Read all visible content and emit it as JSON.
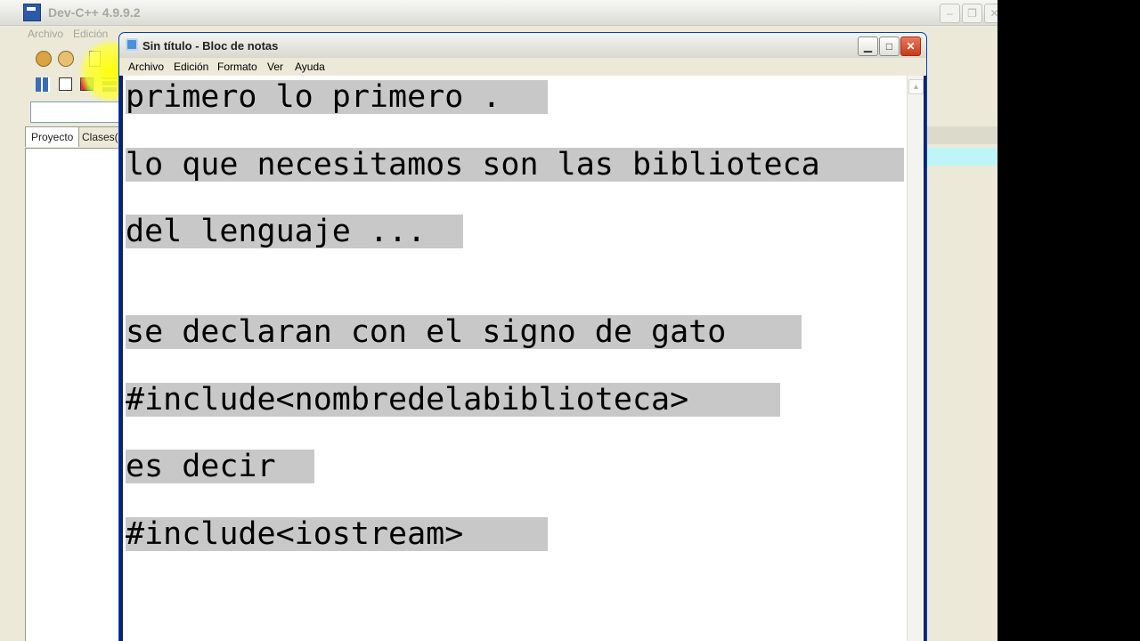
{
  "devcpp": {
    "title": "Dev-C++ 4.9.9.2",
    "menu": [
      "Archivo",
      "Edición"
    ],
    "tabs": [
      "Proyecto",
      "Clases(F"
    ]
  },
  "notepad": {
    "title": "Sin título - Bloc de notas",
    "menu": [
      "Archivo",
      "Edición",
      "Formato",
      "Ver",
      "Ayuda"
    ],
    "lines": [
      "primero lo primero .",
      "lo que necesitamos son las biblioteca",
      "del lenguaje ...",
      "se declaran con el signo de gato",
      "#include<nombredelabiblioteca>",
      "es decir",
      "#include<iostream>"
    ]
  },
  "icons": [
    "devcpp-app-icon",
    "notepad-app-icon",
    "minimize-icon",
    "maximize-icon",
    "close-icon",
    "scroll-up-arrow-icon"
  ],
  "colors": {
    "selection": "#c8c8c8",
    "xp_close": "#c8391b",
    "highlight": "#ffff00"
  }
}
